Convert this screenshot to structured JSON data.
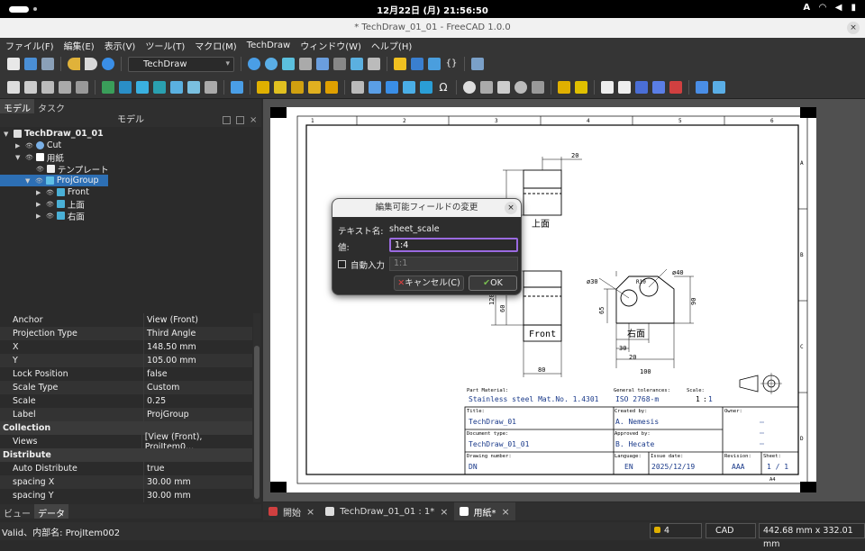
{
  "system": {
    "clock": "12月22日 (月)  21:56:50",
    "input_method": "A"
  },
  "window": {
    "title": "* TechDraw_01_01 - FreeCAD 1.0.0",
    "close": "×"
  },
  "menu": [
    "ファイル(F)",
    "編集(E)",
    "表示(V)",
    "ツール(T)",
    "マクロ(M)",
    "TechDraw",
    "ウィンドウ(W)",
    "ヘルプ(H)"
  ],
  "workbench": "TechDraw",
  "left_tabs": {
    "model": "モデル",
    "task": "タスク"
  },
  "tree_header": "モデル",
  "tree": [
    {
      "label": "TechDraw_01_01"
    },
    {
      "label": "Cut"
    },
    {
      "label": "用紙"
    },
    {
      "label": "テンプレート"
    },
    {
      "label": "ProjGroup"
    },
    {
      "label": "Front"
    },
    {
      "label": "上面"
    },
    {
      "label": "右面"
    }
  ],
  "properties": [
    {
      "key": "Anchor",
      "value": "View (Front)"
    },
    {
      "key": "Projection Type",
      "value": "Third Angle"
    },
    {
      "key": "X",
      "value": "148.50 mm"
    },
    {
      "key": "Y",
      "value": "105.00 mm"
    },
    {
      "key": "Lock Position",
      "value": "false"
    },
    {
      "key": "Scale Type",
      "value": "Custom"
    },
    {
      "key": "Scale",
      "value": "0.25"
    },
    {
      "key": "Label",
      "value": "ProjGroup"
    },
    {
      "key": "Collection",
      "value": ""
    },
    {
      "key": "Views",
      "value": "[View (Front), ProjItem0..."
    },
    {
      "key": "Distribute",
      "value": ""
    },
    {
      "key": "Auto Distribute",
      "value": "true"
    },
    {
      "key": "spacing X",
      "value": "30.00 mm"
    },
    {
      "key": "spacing Y",
      "value": "30.00 mm"
    }
  ],
  "bottom_tabs": {
    "view": "ビュー",
    "data": "データ"
  },
  "doc_tabs": [
    {
      "label": "開始"
    },
    {
      "label": "TechDraw_01_01 : 1*"
    },
    {
      "label": "用紙*"
    }
  ],
  "status": {
    "message": "Valid、内部名: ProjItem002",
    "count": "4",
    "nav": "CAD",
    "dimensions": "442.68 mm x 332.01 mm"
  },
  "dialog": {
    "title": "編集可能フィールドの変更",
    "close": "×",
    "name_label": "テキスト名:",
    "name_value": "sheet_scale",
    "value_label": "値:",
    "value": "1:4",
    "auto_label": "自動入力",
    "auto_value": "1:1",
    "cancel": "キャンセル(C)",
    "ok": "OK"
  },
  "drawing": {
    "top_label": "上面",
    "front_label": "Front",
    "right_label": "右面",
    "dims": {
      "d20": "20",
      "d30a": "30",
      "d20b": "20",
      "d100": "100",
      "d80": "80",
      "d65": "65",
      "d90": "90",
      "d120": "120",
      "d60": "60",
      "dia30": "ø30",
      "dia40": "ø40",
      "r10": "R10",
      "d75": "45"
    },
    "col_nums": [
      "1",
      "2",
      "3",
      "4",
      "5",
      "6"
    ],
    "row_letters": [
      "A",
      "B",
      "C",
      "D"
    ],
    "part_material_label": "Part Material:",
    "part_material": "Stainless steel Mat.No. 1.4301",
    "tolerances_label": "General tolerances:",
    "tolerances": "ISO 2768-m",
    "scale_label": "Scale:",
    "scale_left": "1",
    "scale_sep": ":",
    "scale_right": "1",
    "title_label": "Title:",
    "title_value": "TechDraw_01",
    "created_label": "Created by:",
    "created_value": "A. Nemesis",
    "owner_label": "Owner:",
    "doctype_label": "Document type:",
    "doctype_value": "TechDraw_01_01",
    "approved_label": "Approved by:",
    "approved_value": "B. Hecate",
    "drawnum_label": "Drawing number:",
    "drawnum_value": "DN",
    "lang_label": "Language:",
    "lang_value": "EN",
    "issue_label": "Issue date:",
    "issue_value": "2025/12/19",
    "rev_label": "Revision:",
    "rev_value": "AAA",
    "sheet_label": "Sheet:",
    "sheet_value": "1 / 1",
    "paper": "A4"
  }
}
